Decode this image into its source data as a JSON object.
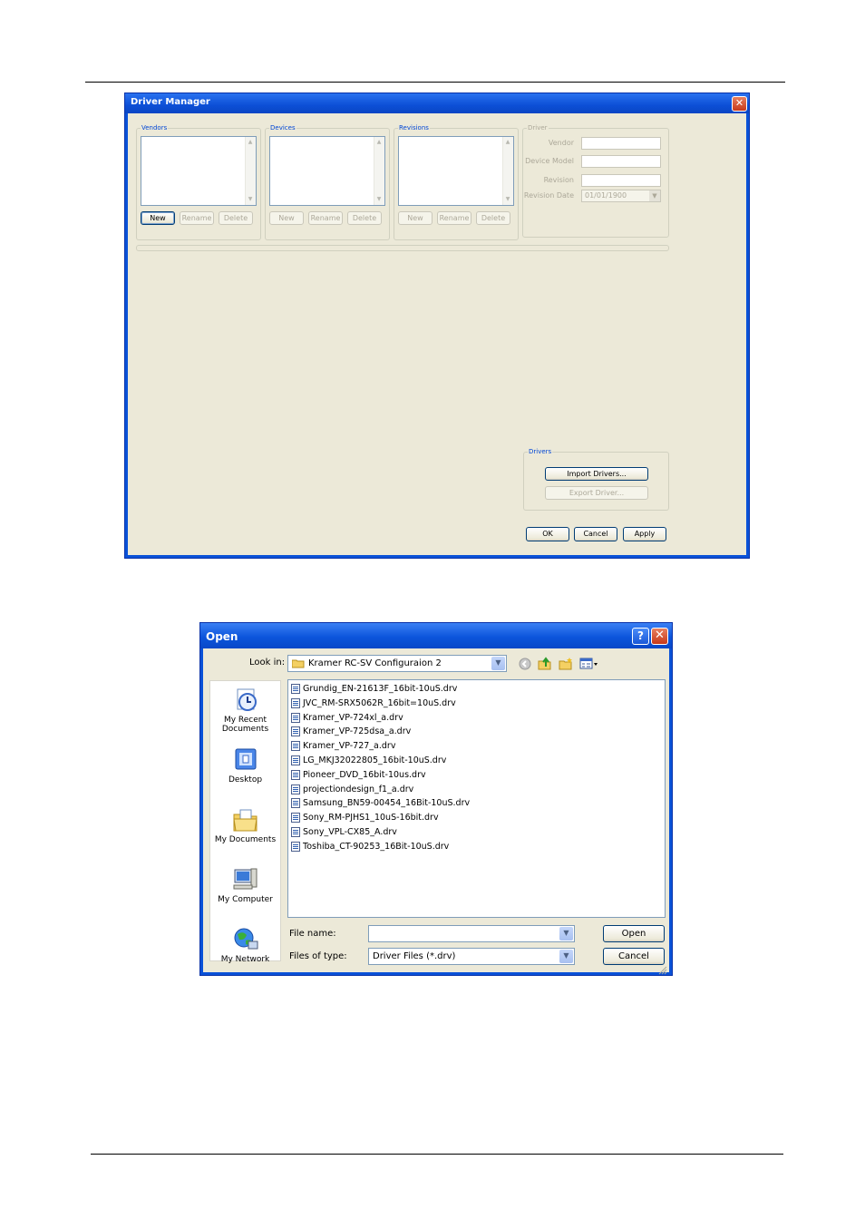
{
  "driver_manager": {
    "title": "Driver Manager",
    "close_glyph": "✕",
    "vendors": {
      "label": "Vendors",
      "buttons": [
        "New",
        "Rename",
        "Delete"
      ]
    },
    "devices": {
      "label": "Devices",
      "buttons": [
        "New",
        "Rename",
        "Delete"
      ]
    },
    "revisions": {
      "label": "Revisions",
      "buttons": [
        "New",
        "Rename",
        "Delete"
      ]
    },
    "driver": {
      "label": "Driver",
      "vendor_label": "Vendor",
      "device_model_label": "Device Model",
      "revision_label": "Revision",
      "revision_date_label": "Revision Date",
      "revision_date_value": "01/01/1900"
    },
    "drivers_group": {
      "label": "Drivers",
      "import_label": "Import Drivers...",
      "export_label": "Export Driver..."
    },
    "ok_label": "OK",
    "cancel_label": "Cancel",
    "apply_label": "Apply"
  },
  "open_dialog": {
    "title": "Open",
    "help_glyph": "?",
    "close_glyph": "✕",
    "look_in_label": "Look in:",
    "look_in_value": "Kramer RC-SV Configuraion 2",
    "places": [
      {
        "label_line1": "My Recent",
        "label_line2": "Documents",
        "icon": "recent-documents-icon"
      },
      {
        "label_line1": "Desktop",
        "label_line2": "",
        "icon": "desktop-icon"
      },
      {
        "label_line1": "My Documents",
        "label_line2": "",
        "icon": "my-documents-icon"
      },
      {
        "label_line1": "My Computer",
        "label_line2": "",
        "icon": "my-computer-icon"
      },
      {
        "label_line1": "My Network",
        "label_line2": "",
        "icon": "my-network-icon"
      }
    ],
    "files": [
      "Grundig_EN-21613F_16bit-10uS.drv",
      "JVC_RM-SRX5062R_16bit=10uS.drv",
      "Kramer_VP-724xl_a.drv",
      "Kramer_VP-725dsa_a.drv",
      "Kramer_VP-727_a.drv",
      "LG_MKJ32022805_16bit-10uS.drv",
      "Pioneer_DVD_16bit-10us.drv",
      "projectiondesign_f1_a.drv",
      "Samsung_BN59-00454_16Bit-10uS.drv",
      "Sony_RM-PJHS1_10uS-16bit.drv",
      "Sony_VPL-CX85_A.drv",
      "Toshiba_CT-90253_16Bit-10uS.drv"
    ],
    "file_name_label": "File name:",
    "file_name_value": "",
    "files_of_type_label": "Files of type:",
    "files_of_type_value": "Driver Files (*.drv)",
    "open_label": "Open",
    "cancel_label": "Cancel",
    "colors": {
      "titlebar": "#0a52d8",
      "face": "#ece9d8",
      "close": "#c8391a"
    }
  }
}
